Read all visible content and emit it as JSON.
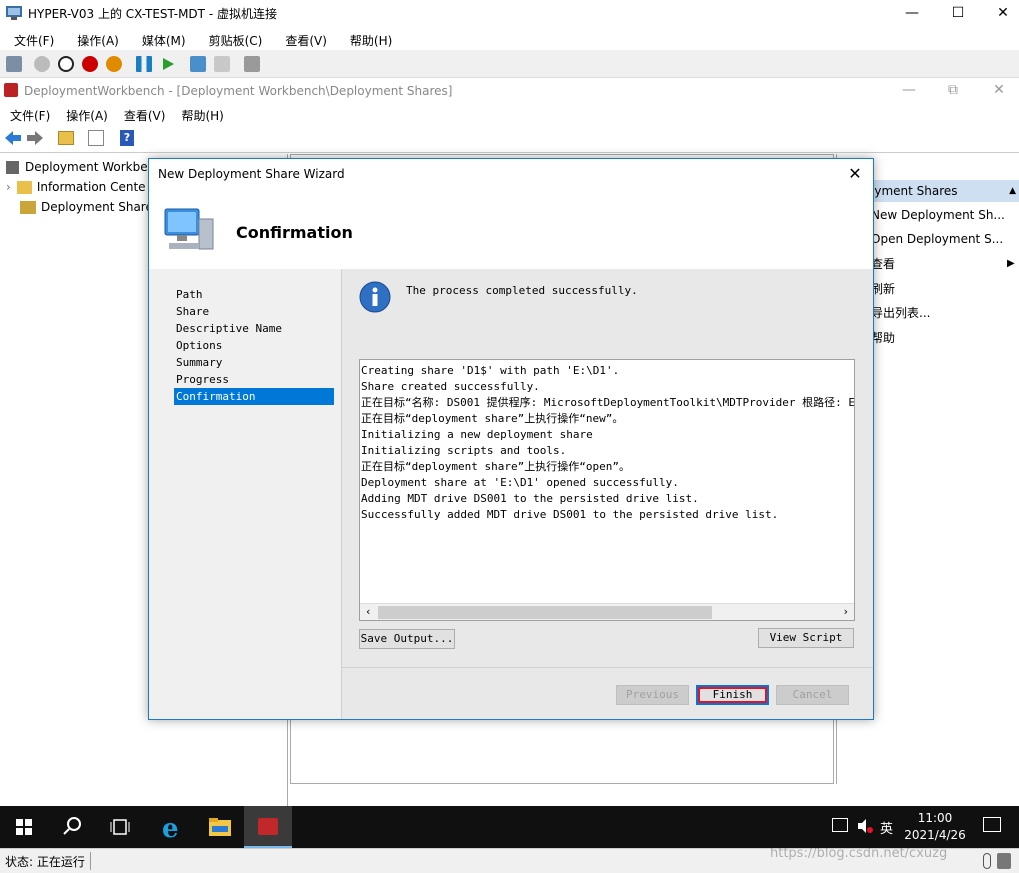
{
  "vm_window": {
    "title": "HYPER-V03 上的 CX-TEST-MDT - 虚拟机连接",
    "menu": [
      "文件(F)",
      "操作(A)",
      "媒体(M)",
      "剪贴板(C)",
      "查看(V)",
      "帮助(H)"
    ]
  },
  "mmc_window": {
    "title": "DeploymentWorkbench - [Deployment Workbench\\Deployment Shares]",
    "menu": [
      "文件(F)",
      "操作(A)",
      "查看(V)",
      "帮助(H)"
    ]
  },
  "tree": {
    "root": "Deployment Workbe",
    "items": [
      "Information Cente",
      "Deployment Share"
    ]
  },
  "actions": {
    "header": "oyment Shares",
    "items": [
      "New Deployment Sh...",
      "Open Deployment S...",
      "查看",
      "刷新",
      "导出列表...",
      "帮助"
    ]
  },
  "wizard": {
    "title": "New Deployment Share Wizard",
    "heading": "Confirmation",
    "steps": [
      "Path",
      "Share",
      "Descriptive Name",
      "Options",
      "Summary",
      "Progress",
      "Confirmation"
    ],
    "active_step": "Confirmation",
    "message": "The process completed successfully.",
    "log": [
      "Creating share 'D1$' with path 'E:\\D1'.",
      "Share created successfully.",
      "正在目标“名称: DS001 提供程序: MicrosoftDeploymentToolkit\\MDTProvider 根路径: E:\\",
      "正在目标“deployment share”上执行操作“new”。",
      "Initializing a new deployment share",
      "Initializing scripts and tools.",
      "正在目标“deployment share”上执行操作“open”。",
      "Deployment share at 'E:\\D1' opened successfully.",
      "Adding MDT drive DS001 to the persisted drive list.",
      "Successfully added MDT drive DS001 to the persisted drive list."
    ],
    "buttons": {
      "save_output": "Save Output...",
      "view_script": "View Script",
      "previous": "Previous",
      "finish": "Finish",
      "cancel": "Cancel"
    }
  },
  "taskbar": {
    "time": "11:00",
    "date": "2021/4/26",
    "ime": "英"
  },
  "status": {
    "text": "状态: 正在运行",
    "watermark": "https://blog.csdn.net/cxuzg"
  },
  "colors": {
    "accent": "#0078d7",
    "finish_highlight": "#e81123"
  }
}
